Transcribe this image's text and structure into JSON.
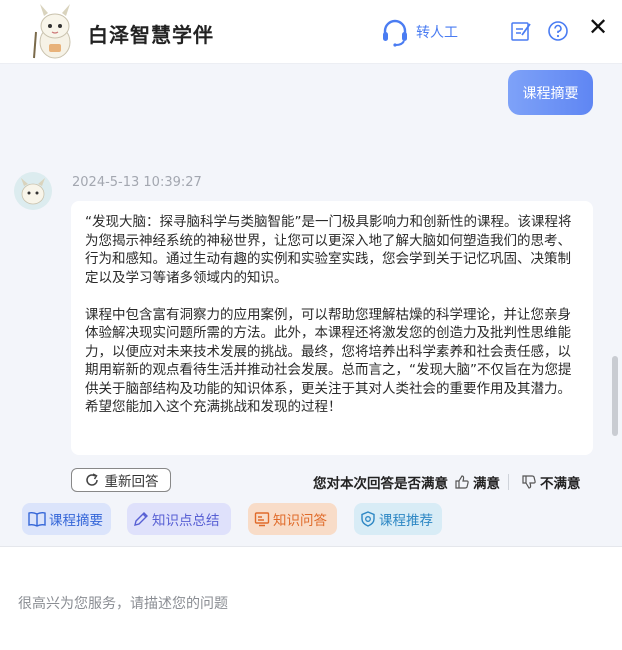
{
  "header": {
    "title": "白泽智慧学伴",
    "transfer_label": "转人工",
    "icons": [
      "mascot-logo",
      "headset-icon",
      "notepad-icon",
      "help-icon",
      "close-icon"
    ],
    "close_glyph": "✕"
  },
  "chat": {
    "user_message": "课程摘要",
    "timestamp": "2024-5-13 10:39:27",
    "answer_paragraphs": [
      "“发现大脑：探寻脑科学与类脑智能”是一门极具影响力和创新性的课程。该课程将为您揭示神经系统的神秘世界，让您可以更深入地了解大脑如何塑造我们的思考、行为和感知。通过生动有趣的实例和实验室实践，您会学到关于记忆巩固、决策制定以及学习等诸多领域内的知识。",
      "课程中包含富有洞察力的应用案例，可以帮助您理解枯燥的科学理论，并让您亲身体验解决现实问题所需的方法。此外，本课程还将激发您的创造力及批判性思维能力，以便应对未来技术发展的挑战。最终，您将培养出科学素养和社会责任感，以期用崭新的观点看待生活并推动社会发展。总而言之，“发现大脑”不仅旨在为您提供关于脑部结构及功能的知识体系，更关注于其对人类社会的重要作用及其潜力。希望您能加入这个充满挑战和发现的过程！"
    ],
    "regenerate_label": "重新回答",
    "feedback_prompt": "您对本次回答是否满意",
    "satisfied_label": "满意",
    "unsatisfied_label": "不满意"
  },
  "quick_actions": [
    {
      "label": "课程摘要",
      "icon": "book-icon",
      "color": "#3466d8"
    },
    {
      "label": "知识点总结",
      "icon": "pen-icon",
      "color": "#5860d4"
    },
    {
      "label": "知识问答",
      "icon": "screen-icon",
      "color": "#e06b2a"
    },
    {
      "label": "课程推荐",
      "icon": "badge-icon",
      "color": "#2d87c4"
    }
  ],
  "input": {
    "placeholder": "很高兴为您服务，请描述您的问题",
    "value": ""
  },
  "colors": {
    "accent": "#4a7cf2",
    "chat_background": "#f3f5fa",
    "user_bubble": "#6b8ff5"
  }
}
